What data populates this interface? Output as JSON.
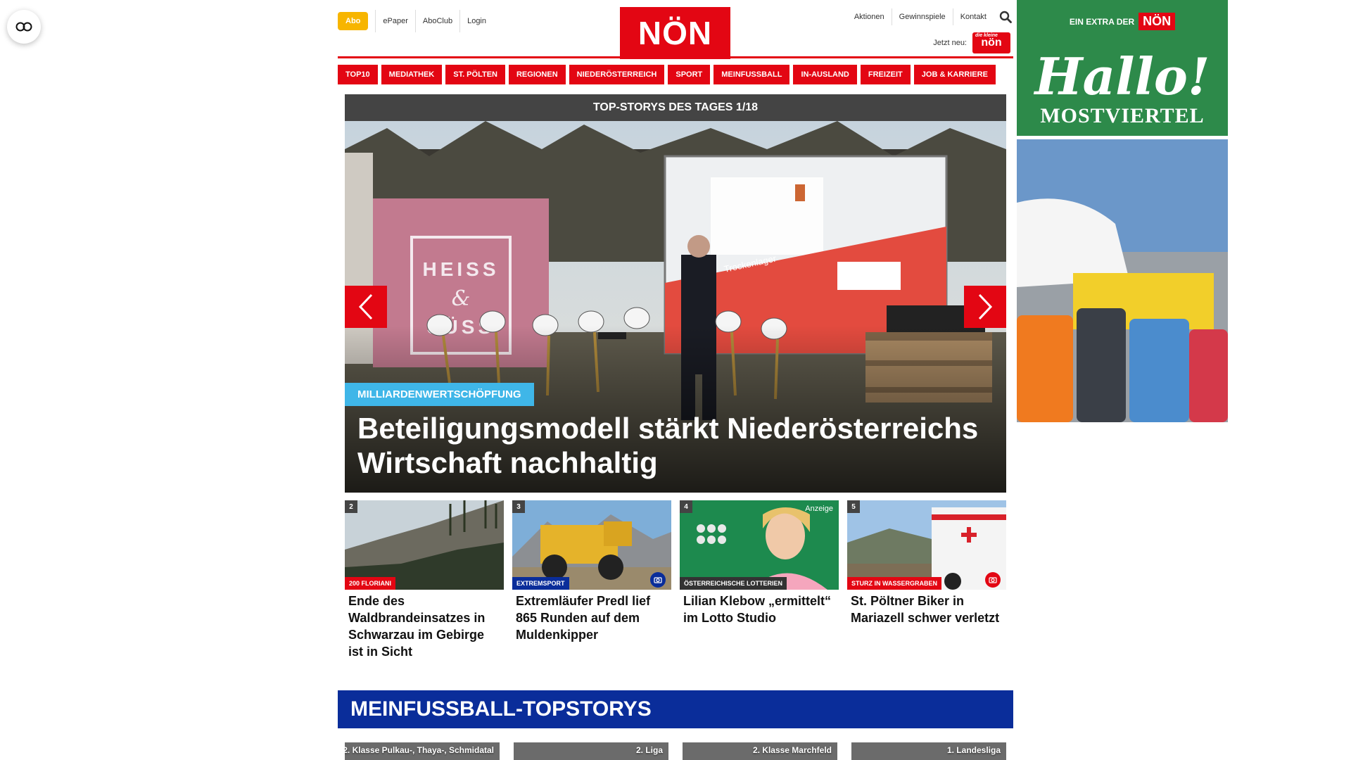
{
  "header": {
    "abo_label": "Abo",
    "top_links": [
      "ePaper",
      "AboClub",
      "Login"
    ],
    "logo_text": "NÖN",
    "right_links": [
      "Aktionen",
      "Gewinnspiele",
      "Kontakt"
    ],
    "jetzt_neu": "Jetzt neu:",
    "badge_text": "nön",
    "badge_small": "die kleine"
  },
  "nav": [
    "TOP10",
    "MEDIATHEK",
    "ST. PÖLTEN",
    "REGIONEN",
    "NIEDERÖSTERREICH",
    "SPORT",
    "MEINFUSSBALL",
    "IN-AUSLAND",
    "FREIZEIT",
    "JOB & KARRIERE"
  ],
  "hero": {
    "heading": "TOP-STORYS DES TAGES 1/18",
    "tag": "MILLIARDENWERTSCHÖPFUNG",
    "title": "Beteiligungsmodell stärkt Niederösterreichs Wirtschaft nachhaltig"
  },
  "cards": [
    {
      "num": "2",
      "tag": "200 FLORIANI",
      "title": "Ende des Waldbrandeinsatzes in Schwarzau im Gebirge ist in Sicht"
    },
    {
      "num": "3",
      "tag": "EXTREMSPORT",
      "title": "Extremläufer Predl lief 865 Runden auf dem Muldenkipper"
    },
    {
      "num": "4",
      "tag": "ÖSTERREICHISCHE LOTTERIEN",
      "badge": "Anzeige",
      "title": "Lilian Klebow „ermittelt“ im Lotto Studio"
    },
    {
      "num": "5",
      "tag": "STURZ IN WASSERGRABEN",
      "title": "St. Pöltner Biker in Mariazell schwer verletzt"
    }
  ],
  "meinfussball": {
    "title": "MEINFUSSBALL-TOPSTORYS",
    "cards": [
      "2. Klasse Pulkau-, Thaya-, Schmidatal",
      "2. Liga",
      "2. Klasse Marchfeld",
      "1. Landesliga"
    ]
  },
  "ad": {
    "extra": "EIN EXTRA DER",
    "extra_logo": "NÖN",
    "hallo": "Hallo!",
    "region": "MOSTVIERTEL"
  },
  "colors": {
    "brand_red": "#e30613",
    "nav_blue": "#0a2d9a",
    "tag_blue": "#3fb6e8",
    "abo_yellow": "#f7b500"
  }
}
